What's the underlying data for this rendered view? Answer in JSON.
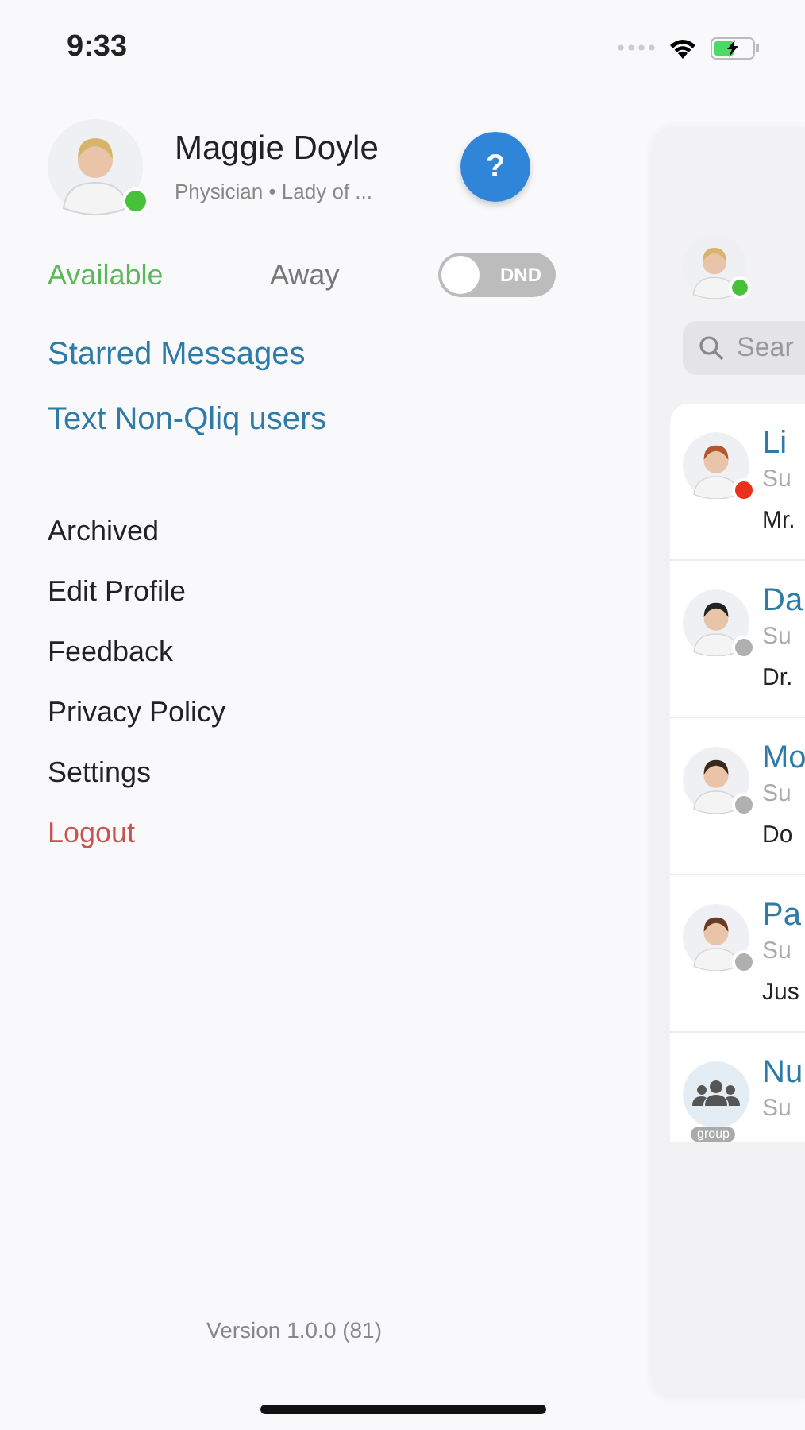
{
  "status_bar": {
    "time": "9:33"
  },
  "profile": {
    "name": "Maggie Doyle",
    "subtitle": "Physician • Lady of ...",
    "help": "?"
  },
  "presence": [
    {
      "label": "Available",
      "selected": true
    },
    {
      "label": "Away",
      "selected": false
    }
  ],
  "dnd": {
    "label": "DND",
    "on": false
  },
  "links": [
    "Starred Messages",
    "Text Non-Qliq users"
  ],
  "menu": [
    {
      "label": "Archived",
      "kind": "normal"
    },
    {
      "label": "Edit Profile",
      "kind": "normal"
    },
    {
      "label": "Feedback",
      "kind": "normal"
    },
    {
      "label": "Privacy Policy",
      "kind": "normal"
    },
    {
      "label": "Settings",
      "kind": "normal"
    },
    {
      "label": "Logout",
      "kind": "danger"
    }
  ],
  "version": "Version 1.0.0 (81)",
  "panel": {
    "search": {
      "placeholder": "Sear"
    },
    "conversations": [
      {
        "kind": "person",
        "name": "Li",
        "subject": "Su",
        "message": "Mr.",
        "color": "#e8321e"
      },
      {
        "kind": "person",
        "name": "Da",
        "subject": "Su",
        "message": "Dr.",
        "color": "#b0b0b0"
      },
      {
        "kind": "person",
        "name": "Mo",
        "subject": "Su",
        "message": "Do",
        "color": "#b0b0b0"
      },
      {
        "kind": "person",
        "name": "Pa",
        "subject": "Su",
        "message": "Jus",
        "color": "#b0b0b0"
      },
      {
        "kind": "group",
        "name": "Nu",
        "subject": "Su",
        "badge": "group"
      }
    ]
  }
}
